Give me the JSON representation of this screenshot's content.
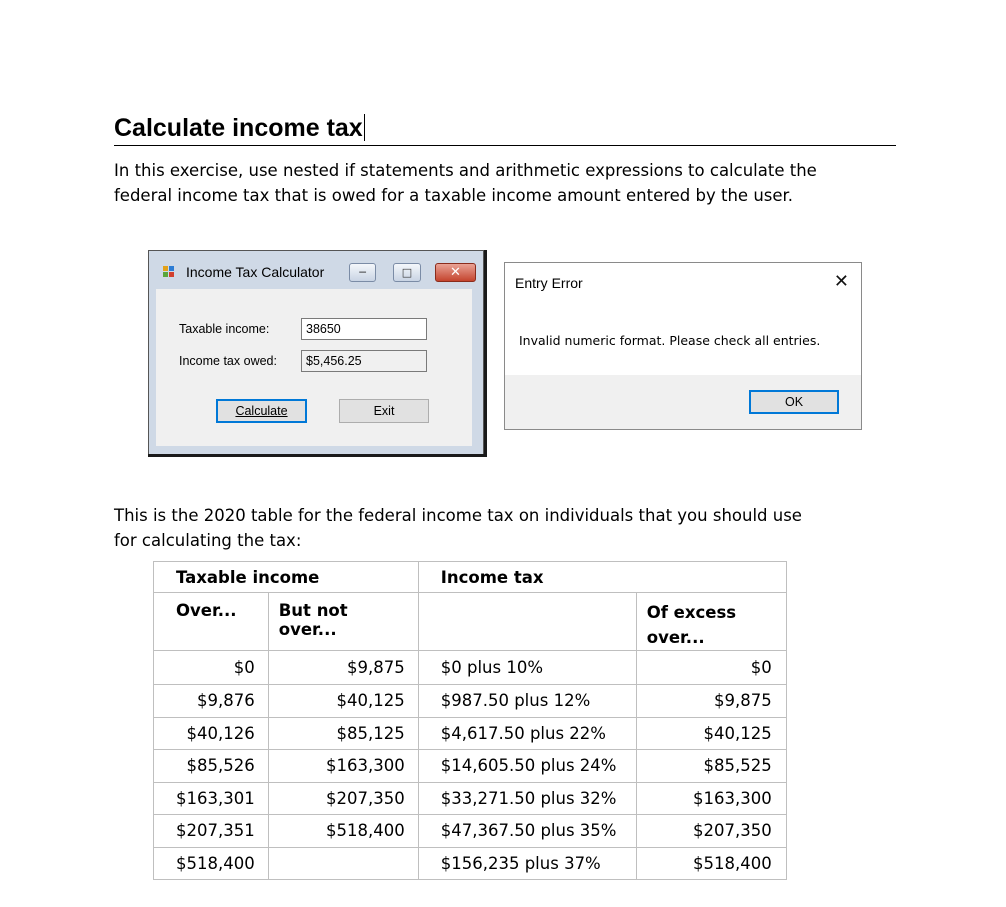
{
  "heading": "Calculate income tax",
  "intro": "In this exercise, use nested if statements and arithmetic expressions to calculate the federal income tax that is owed for a taxable income amount entered by the user.",
  "calc_window": {
    "title": "Income Tax Calculator",
    "taxable_label": "Taxable income:",
    "taxable_value": "38650",
    "owed_label": "Income tax owed:",
    "owed_value": "$5,456.25",
    "calc_button": "Calculate",
    "exit_button": "Exit",
    "icon_colors": [
      "#e3a21a",
      "#2d7cd4",
      "#5aa63c",
      "#d23f2f"
    ]
  },
  "error_dialog": {
    "title": "Entry Error",
    "message": "Invalid numeric format. Please check all entries.",
    "ok_button": "OK"
  },
  "table_intro": "This is the 2020 table for the federal income tax on individuals that you should use for calculating the tax:",
  "tax_table": {
    "group_headers": [
      "Taxable income",
      "Income tax"
    ],
    "col_headers": [
      "Over...",
      "But not over...",
      "",
      "Of excess over..."
    ],
    "rows": [
      [
        "$0",
        "$9,875",
        "$0 plus 10%",
        "$0"
      ],
      [
        "$9,876",
        "$40,125",
        "$987.50 plus 12%",
        "$9,875"
      ],
      [
        "$40,126",
        "$85,125",
        "$4,617.50 plus 22%",
        "$40,125"
      ],
      [
        "$85,526",
        "$163,300",
        "$14,605.50 plus 24%",
        "$85,525"
      ],
      [
        "$163,301",
        "$207,350",
        "$33,271.50 plus 32%",
        "$163,300"
      ],
      [
        "$207,351",
        "$518,400",
        "$47,367.50 plus 35%",
        "$207,350"
      ],
      [
        "$518,400",
        "",
        "$156,235 plus 37%",
        "$518,400"
      ]
    ]
  }
}
